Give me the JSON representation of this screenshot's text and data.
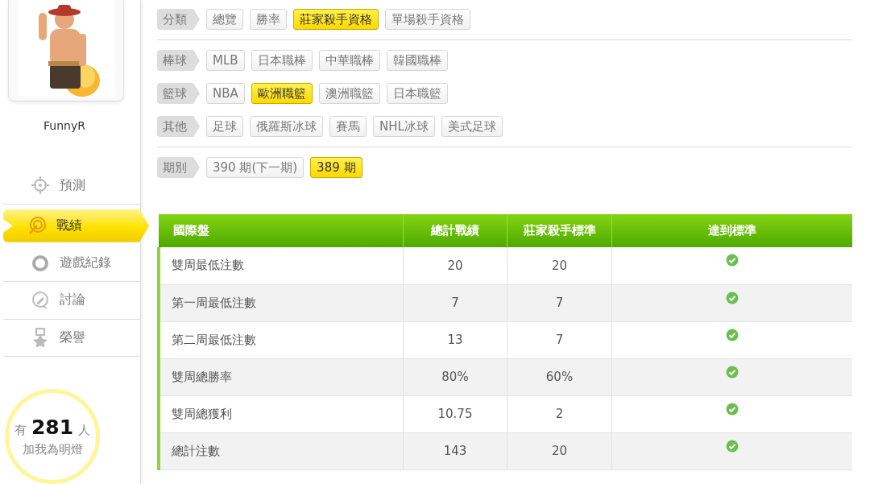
{
  "profile": {
    "username": "FunnyR"
  },
  "menu": [
    {
      "label": "預測",
      "selected": false
    },
    {
      "label": "戰績",
      "selected": true
    },
    {
      "label": "遊戲紀錄",
      "selected": false
    },
    {
      "label": "討論",
      "selected": false
    },
    {
      "label": "榮譽",
      "selected": false
    }
  ],
  "fans": {
    "prefix": "有",
    "count": "281",
    "suffix": "人",
    "caption": "加我為明燈"
  },
  "filter_sections": [
    {
      "groups": [
        {
          "label": "分類",
          "options": [
            {
              "label": "總覽",
              "selected": false
            },
            {
              "label": "勝率",
              "selected": false
            },
            {
              "label": "莊家殺手資格",
              "selected": true
            },
            {
              "label": "單場殺手資格",
              "selected": false
            }
          ]
        }
      ]
    },
    {
      "groups": [
        {
          "label": "棒球",
          "options": [
            {
              "label": "MLB",
              "selected": false
            },
            {
              "label": "日本職棒",
              "selected": false
            },
            {
              "label": "中華職棒",
              "selected": false
            },
            {
              "label": "韓國職棒",
              "selected": false
            }
          ]
        },
        {
          "label": "籃球",
          "options": [
            {
              "label": "NBA",
              "selected": false
            },
            {
              "label": "歐洲職籃",
              "selected": true
            },
            {
              "label": "澳洲職籃",
              "selected": false
            },
            {
              "label": "日本職籃",
              "selected": false
            }
          ]
        },
        {
          "label": "其他",
          "options": [
            {
              "label": "足球",
              "selected": false
            },
            {
              "label": "俄羅斯冰球",
              "selected": false
            },
            {
              "label": "賽馬",
              "selected": false
            },
            {
              "label": "NHL冰球",
              "selected": false
            },
            {
              "label": "美式足球",
              "selected": false
            }
          ]
        }
      ]
    },
    {
      "groups": [
        {
          "label": "期別",
          "options": [
            {
              "label": "390 期(下一期)",
              "selected": false
            },
            {
              "label": "389 期",
              "selected": true
            }
          ]
        }
      ]
    }
  ],
  "table": {
    "columns": [
      "國際盤",
      "總計戰績",
      "莊家殺手標準",
      "達到標準"
    ],
    "rows": [
      {
        "item": "雙周最低注數",
        "total": "20",
        "standard": "20",
        "met": true
      },
      {
        "item": "第一周最低注數",
        "total": "7",
        "standard": "7",
        "met": true
      },
      {
        "item": "第二周最低注數",
        "total": "13",
        "standard": "7",
        "met": true
      },
      {
        "item": "雙周總勝率",
        "total": "80%",
        "standard": "60%",
        "met": true
      },
      {
        "item": "雙周總獲利",
        "total": "10.75",
        "standard": "2",
        "met": true
      },
      {
        "item": "總計注數",
        "total": "143",
        "standard": "20",
        "met": true
      }
    ]
  }
}
